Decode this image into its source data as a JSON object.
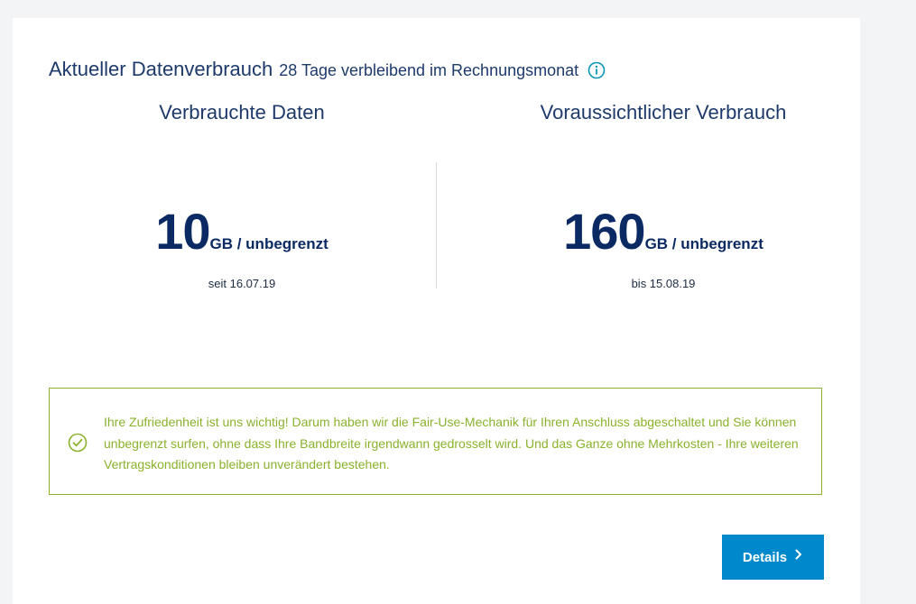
{
  "header": {
    "title": "Aktueller Datenverbrauch",
    "subtitle": "28 Tage verbleibend im Rechnungsmonat",
    "info_icon": "info-circle-icon"
  },
  "usage": {
    "consumed": {
      "heading": "Verbrauchte Daten",
      "value": "10",
      "unit": "GB / unbegrenzt",
      "date": "seit 16.07.19"
    },
    "forecast": {
      "heading": "Voraussichtlicher Verbrauch",
      "value": "160",
      "unit": "GB / unbegrenzt",
      "date": "bis 15.08.19"
    }
  },
  "notice": {
    "icon": "check-circle-icon",
    "text": "Ihre Zufriedenheit ist uns wichtig! Darum haben wir die Fair-Use-Mechanik für Ihren Anschluss abgeschaltet und Sie können unbegrenzt surfen, ohne dass Ihre Bandbreite irgendwann gedrosselt wird. Und das Ganze ohne Mehrkosten - Ihre weiteren Vertragskonditionen bleiben unverändert bestehen.",
    "color": "#8ab22c"
  },
  "actions": {
    "details_label": "Details",
    "details_icon": "chevron-right-icon"
  },
  "colors": {
    "heading": "#1d3a6b",
    "value": "#0b2a63",
    "accent": "#0088cc",
    "success": "#8ab22c"
  }
}
